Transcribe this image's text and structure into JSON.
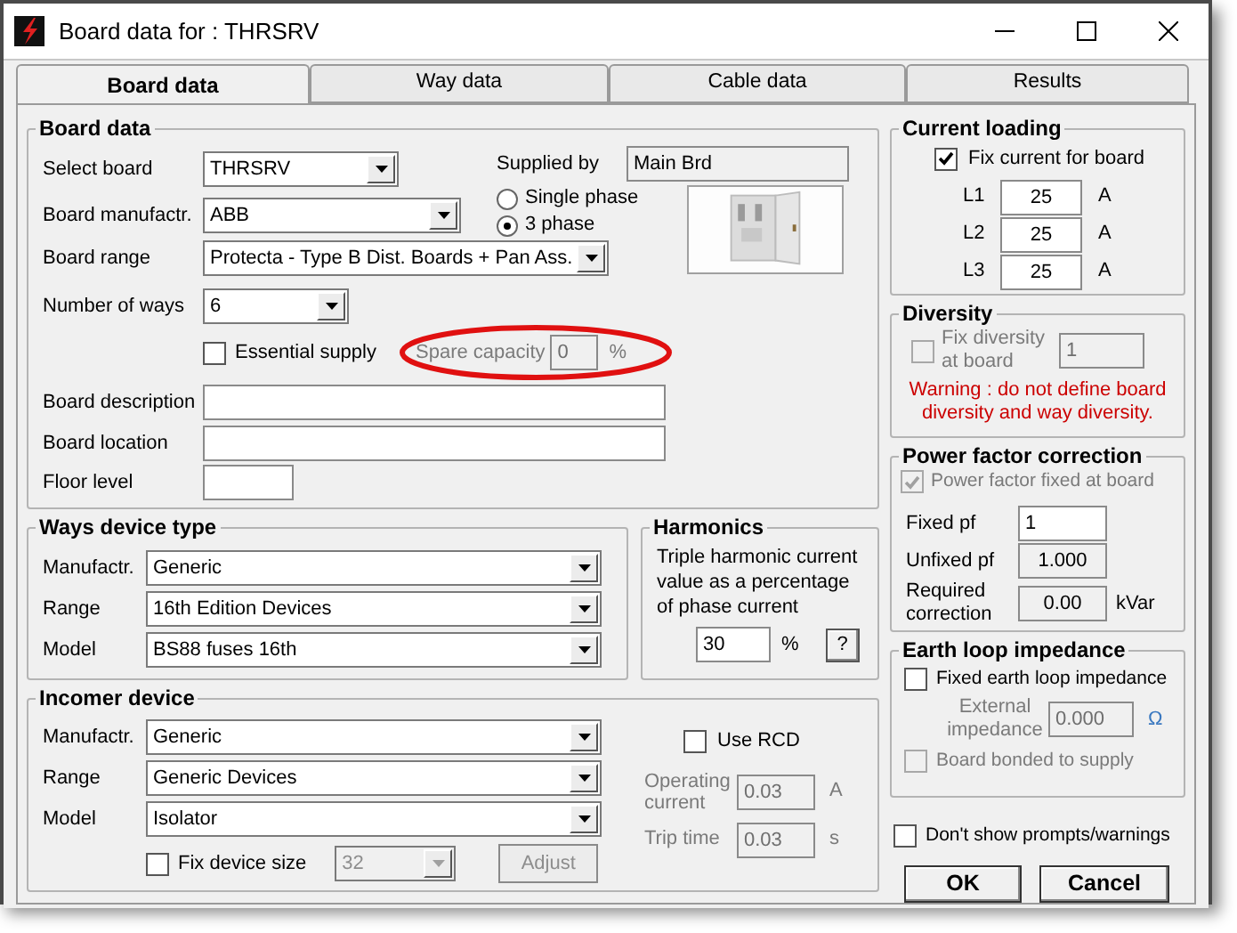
{
  "window": {
    "title": "Board data for : THRSRV"
  },
  "tabs": [
    {
      "label": "Board data",
      "selected": true
    },
    {
      "label": "Way data",
      "selected": false
    },
    {
      "label": "Cable data",
      "selected": false
    },
    {
      "label": "Results",
      "selected": false
    }
  ],
  "board_data": {
    "title": "Board data",
    "select_board": {
      "label": "Select board",
      "value": "THRSRV"
    },
    "manufacturer": {
      "label": "Board manufactr.",
      "value": "ABB"
    },
    "range": {
      "label": "Board range",
      "value": "Protecta - Type B Dist. Boards + Pan Ass."
    },
    "ways": {
      "label": "Number of ways",
      "value": "6"
    },
    "supplied_by": {
      "label": "Supplied by",
      "value": "Main Brd"
    },
    "phases": [
      {
        "label": "Single phase",
        "selected": false
      },
      {
        "label": "3 phase",
        "selected": true
      }
    ],
    "essential_supply": {
      "label": "Essential supply",
      "checked": false
    },
    "spare_capacity": {
      "label": "Spare capacity",
      "value": "0",
      "unit": "%",
      "disabled": true,
      "highlighted": true
    },
    "description": {
      "label": "Board description"
    },
    "location": {
      "label": "Board location"
    },
    "floor_level": {
      "label": "Floor level"
    }
  },
  "ways_device_type": {
    "title": "Ways device type",
    "rows": [
      {
        "label": "Manufactr.",
        "value": "Generic"
      },
      {
        "label": "Range",
        "value": "16th Edition Devices"
      },
      {
        "label": "Model",
        "value": "BS88 fuses 16th"
      }
    ]
  },
  "harmonics": {
    "title": "Harmonics",
    "text": "Triple harmonic current value as a percentage of phase current",
    "value": "30",
    "unit": "%",
    "help": "?"
  },
  "incomer_device": {
    "title": "Incomer device",
    "rows": [
      {
        "label": "Manufactr.",
        "value": "Generic"
      },
      {
        "label": "Range",
        "value": "Generic Devices"
      },
      {
        "label": "Model",
        "value": "Isolator"
      }
    ],
    "fix_device_size": {
      "label": "Fix device size",
      "checked": false
    },
    "device_size": {
      "value": "32",
      "disabled": true
    },
    "adjust": {
      "label": "Adjust",
      "disabled": true
    },
    "use_rcd": {
      "label": "Use RCD",
      "checked": false
    },
    "operating_current": {
      "label": "Operating current",
      "value": "0.03",
      "unit": "A",
      "disabled": true
    },
    "trip_time": {
      "label": "Trip time",
      "value": "0.03",
      "unit": "s",
      "disabled": true
    }
  },
  "current_loading": {
    "title": "Current loading",
    "fix": {
      "label": "Fix current for board",
      "checked": true
    },
    "phases": [
      {
        "label": "L1",
        "value": "25",
        "unit": "A"
      },
      {
        "label": "L2",
        "value": "25",
        "unit": "A"
      },
      {
        "label": "L3",
        "value": "25",
        "unit": "A"
      }
    ]
  },
  "diversity": {
    "title": "Diversity",
    "fix": {
      "label": "Fix diversity at board",
      "checked": false,
      "disabled": true
    },
    "value": "1",
    "value_disabled": true,
    "warning": "Warning : do not define board diversity and way diversity."
  },
  "power_factor": {
    "title": "Power factor correction",
    "fixed": {
      "label": "Power factor fixed at board",
      "checked": true,
      "disabled": true
    },
    "fixed_pf": {
      "label": "Fixed pf",
      "value": "1"
    },
    "unfixed_pf": {
      "label": "Unfixed pf",
      "value": "1.000"
    },
    "required": {
      "label": "Required correction",
      "value": "0.00",
      "unit": "kVar"
    }
  },
  "earth_loop": {
    "title": "Earth loop impedance",
    "fixed": {
      "label": "Fixed earth loop impedance",
      "checked": false
    },
    "external": {
      "label": "External impedance",
      "value": "0.000",
      "unit": "Ω",
      "disabled": true
    },
    "bonded": {
      "label": "Board bonded to supply",
      "checked": false,
      "disabled": true
    }
  },
  "dont_show": {
    "label": "Don't show prompts/warnings",
    "checked": false
  },
  "buttons": [
    {
      "label": "OK"
    },
    {
      "label": "Cancel"
    }
  ]
}
